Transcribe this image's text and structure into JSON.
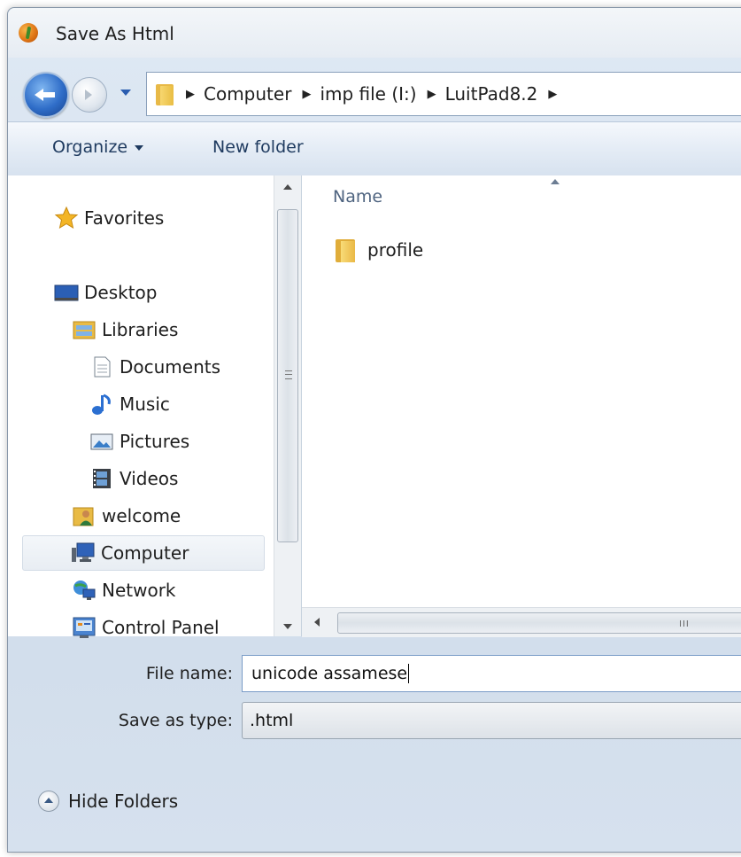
{
  "window": {
    "title": "Save As Html"
  },
  "address": {
    "crumbs": [
      "Computer",
      "imp file (I:)",
      "LuitPad8.2"
    ]
  },
  "toolbar": {
    "organize_label": "Organize",
    "new_folder_label": "New folder"
  },
  "nav": {
    "items": [
      {
        "label": "Favorites",
        "icon": "star-icon"
      },
      {
        "label": "Desktop",
        "icon": "desktop-icon"
      },
      {
        "label": "Libraries",
        "icon": "libraries-icon"
      },
      {
        "label": "Documents",
        "icon": "documents-icon"
      },
      {
        "label": "Music",
        "icon": "music-icon"
      },
      {
        "label": "Pictures",
        "icon": "pictures-icon"
      },
      {
        "label": "Videos",
        "icon": "videos-icon"
      },
      {
        "label": "welcome",
        "icon": "user-folder-icon"
      },
      {
        "label": "Computer",
        "icon": "computer-icon",
        "selected": true
      },
      {
        "label": "Network",
        "icon": "network-icon"
      },
      {
        "label": "Control Panel",
        "icon": "control-panel-icon"
      }
    ]
  },
  "files": {
    "column_name": "Name",
    "items": [
      {
        "name": "profile",
        "type": "folder"
      }
    ]
  },
  "form": {
    "file_name_label": "File name:",
    "file_name_value": "unicode assamese",
    "save_as_type_label": "Save as type:",
    "save_as_type_value": ".html"
  },
  "footer": {
    "hide_folders_label": "Hide Folders"
  },
  "colors": {
    "accent": "#2f6dc8",
    "folder": "#e8b947",
    "selection": "#e8edf3"
  }
}
